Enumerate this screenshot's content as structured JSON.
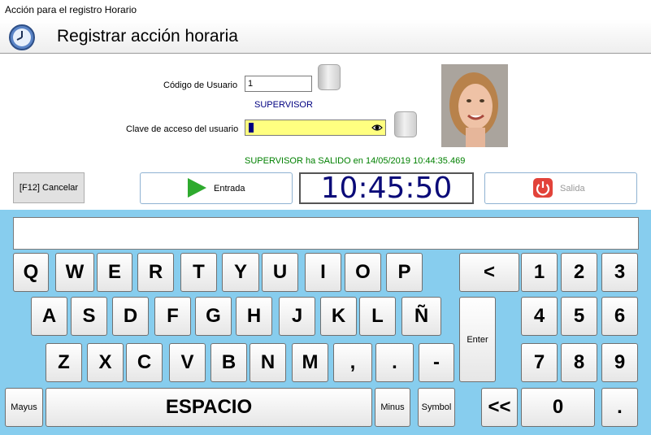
{
  "window": {
    "title": "Acción para el registro Horario"
  },
  "header": {
    "title": "Registrar acción horaria",
    "icon": "clock-icon"
  },
  "form": {
    "user_code_label": "Código de Usuario",
    "user_code_value": "1",
    "user_name": "SUPERVISOR",
    "password_label": "Clave de acceso del usuario"
  },
  "status_message": "SUPERVISOR ha SALIDO en 14/05/2019 10:44:35.469",
  "actions": {
    "cancel": "[F12] Cancelar",
    "entry": "Entrada",
    "time": "10:45:50",
    "exit": "Salida"
  },
  "colors": {
    "keyboard_bg": "#87cdee",
    "password_bg": "#ffff80",
    "status": "#008000",
    "time": "#0a0a78"
  },
  "keyboard": {
    "row1": [
      "Q",
      "W",
      "E",
      "R",
      "T",
      "Y",
      "U",
      "I",
      "O",
      "P"
    ],
    "row2": [
      "A",
      "S",
      "D",
      "F",
      "G",
      "H",
      "J",
      "K",
      "L",
      "Ñ"
    ],
    "row3": [
      "Z",
      "X",
      "C",
      "V",
      "B",
      "N",
      "M",
      ",",
      ".",
      "-"
    ],
    "shift": "Mayus",
    "space": "ESPACIO",
    "lower": "Minus",
    "symbol": "Symbol",
    "backspace": "<",
    "enter": "Enter",
    "clear": "<<",
    "numpad": [
      "1",
      "2",
      "3",
      "4",
      "5",
      "6",
      "7",
      "8",
      "9",
      "0",
      "."
    ]
  }
}
